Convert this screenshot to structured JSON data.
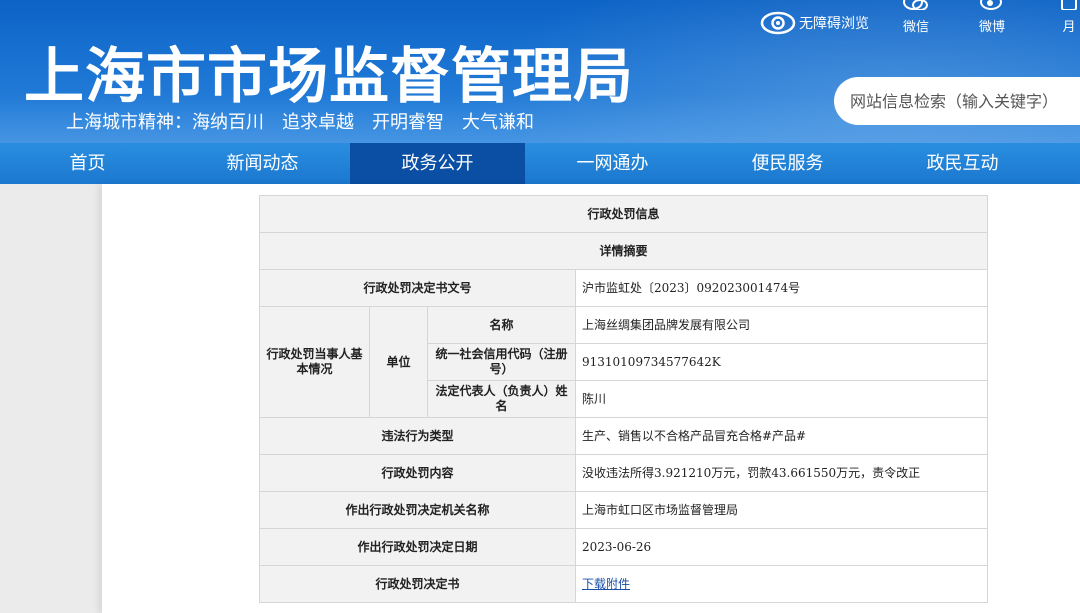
{
  "header": {
    "site_title": "上海市市场监督管理局",
    "slogan": "上海城市精神：海纳百川　追求卓越　开明睿智　大气谦和",
    "accessibility_label": "无障碍浏览",
    "social": [
      {
        "label": "微信",
        "icon": "wechat-icon"
      },
      {
        "label": "微博",
        "icon": "weibo-icon"
      },
      {
        "label": "月",
        "icon": "app-icon"
      }
    ],
    "search_placeholder": "网站信息检索（输入关键字）"
  },
  "nav": {
    "items": [
      {
        "label": "首页"
      },
      {
        "label": "新闻动态"
      },
      {
        "label": "政务公开",
        "active": true
      },
      {
        "label": "一网通办"
      },
      {
        "label": "便民服务"
      },
      {
        "label": "政民互动"
      }
    ]
  },
  "penalty": {
    "title": "行政处罚信息",
    "subtitle": "详情摘要",
    "doc_no_label": "行政处罚决定书文号",
    "doc_no": "沪市监虹处〔2023〕092023001474号",
    "party_label": "行政处罚当事人基本情况",
    "unit_label": "单位",
    "name_label": "名称",
    "name": "上海丝绸集团品牌发展有限公司",
    "credit_code_label": "统一社会信用代码（注册号）",
    "credit_code": "91310109734577642K",
    "legal_rep_label": "法定代表人（负责人）姓名",
    "legal_rep": "陈川",
    "violation_type_label": "违法行为类型",
    "violation_type": "生产、销售以不合格产品冒充合格#产品#",
    "content_label": "行政处罚内容",
    "content": "没收违法所得3.921210万元，罚款43.661550万元，责令改正",
    "authority_label": "作出行政处罚决定机关名称",
    "authority": "上海市虹口区市场监督管理局",
    "date_label": "作出行政处罚决定日期",
    "date": "2023-06-26",
    "decision_doc_label": "行政处罚决定书",
    "decision_doc_link": "下载附件"
  },
  "colors": {
    "header_blue": "#1a73d2",
    "nav_active": "#0a4fa3",
    "link": "#1a4fa8"
  }
}
